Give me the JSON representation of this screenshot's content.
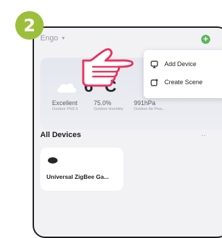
{
  "step": {
    "number": "2",
    "color": "#9cbf3b"
  },
  "header": {
    "home_name": "Engo",
    "add_icon": "plus-circle-icon",
    "accent": "#5bb85d"
  },
  "weather": {
    "temperature": "6 °C",
    "stats": [
      {
        "value": "Excellent",
        "label": "Outdoor PM2.5"
      },
      {
        "value": "75.0%",
        "label": "Outdoor Humidity"
      },
      {
        "value": "991hPa",
        "label": "Outdoor Air Pres..."
      }
    ]
  },
  "devices_section": {
    "title": "All Devices",
    "more": "··"
  },
  "devices": [
    {
      "name": "Universal ZigBee Ga..."
    }
  ],
  "menu": {
    "items": [
      {
        "label": "Add Device",
        "icon": "add-device-icon"
      },
      {
        "label": "Create Scene",
        "icon": "create-scene-icon"
      }
    ]
  }
}
